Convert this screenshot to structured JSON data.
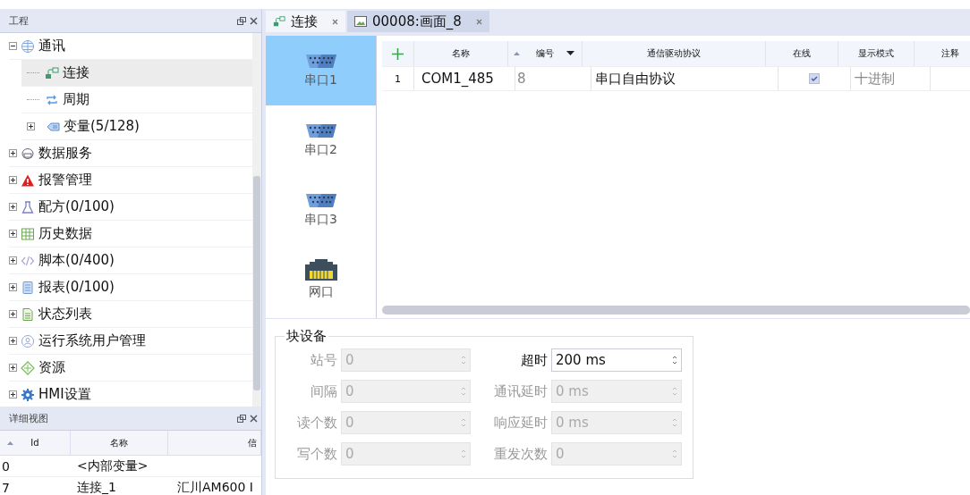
{
  "project_panel": {
    "title": "工程",
    "tree": [
      {
        "label": "通讯",
        "expanded": true,
        "selected": false,
        "children": [
          {
            "label": "连接",
            "selected": true
          },
          {
            "label": "周期",
            "selected": false
          },
          {
            "label": "变量(5/128)",
            "expanded": false,
            "selected": false
          }
        ]
      },
      {
        "label": "数据服务",
        "expanded": false,
        "selected": false
      },
      {
        "label": "报警管理",
        "expanded": false,
        "selected": false
      },
      {
        "label": "配方(0/100)",
        "expanded": false,
        "selected": false
      },
      {
        "label": "历史数据",
        "expanded": false,
        "selected": false
      },
      {
        "label": "脚本(0/400)",
        "expanded": false,
        "selected": false
      },
      {
        "label": "报表(0/100)",
        "expanded": false,
        "selected": false
      },
      {
        "label": "状态列表",
        "expanded": false,
        "selected": false
      },
      {
        "label": "运行系统用户管理",
        "expanded": false,
        "selected": false
      },
      {
        "label": "资源",
        "expanded": false,
        "selected": false
      },
      {
        "label": "HMI设置",
        "expanded": false,
        "selected": false
      }
    ]
  },
  "detail_panel": {
    "title": "详细视图",
    "columns": [
      "Id",
      "名称",
      "信"
    ],
    "rows": [
      [
        "0",
        "<内部变量>",
        ""
      ],
      [
        "7",
        "连接_1",
        "汇川AM600 I"
      ]
    ]
  },
  "tabs": [
    {
      "label": "连接",
      "selected": true
    },
    {
      "label": "00008:画面_8",
      "selected": false
    }
  ],
  "ports": [
    {
      "label": "串口1",
      "kind": "serial",
      "selected": true
    },
    {
      "label": "串口2",
      "kind": "serial",
      "selected": false
    },
    {
      "label": "串口3",
      "kind": "serial",
      "selected": false
    },
    {
      "label": "网口",
      "kind": "ethernet",
      "selected": false
    }
  ],
  "table": {
    "columns": [
      "名称",
      "编号",
      "通信驱动协议",
      "在线",
      "显示模式",
      "注释"
    ],
    "rows": [
      {
        "index": "1",
        "name": "COM1_485",
        "number": "8",
        "protocol": "串口自由协议",
        "online": true,
        "mode": "十进制"
      }
    ]
  },
  "block_device": {
    "title": "块设备",
    "fields": [
      {
        "label": "站号",
        "value": "0",
        "disabled": true
      },
      {
        "label": "超时",
        "value": "200 ms",
        "disabled": false
      },
      {
        "label": "间隔",
        "value": "0",
        "disabled": true
      },
      {
        "label": "通讯延时",
        "value": "0 ms",
        "disabled": true
      },
      {
        "label": "读个数",
        "value": "0",
        "disabled": true
      },
      {
        "label": "响应延时",
        "value": "0 ms",
        "disabled": true
      },
      {
        "label": "写个数",
        "value": "0",
        "disabled": true
      },
      {
        "label": "重发次数",
        "value": "0",
        "disabled": true
      }
    ]
  }
}
